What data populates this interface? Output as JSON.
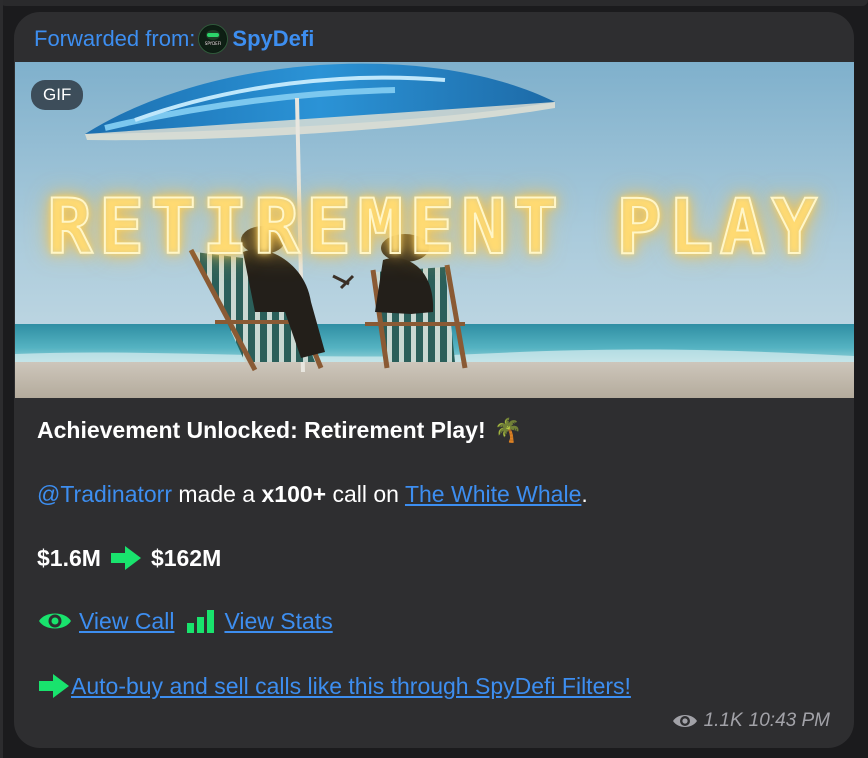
{
  "forwarded": {
    "prefix": "Forwarded from:",
    "channel": "SpyDefi",
    "avatar_icon": "spydefi-logo-icon"
  },
  "media": {
    "badge": "GIF",
    "overlay_text": "RETIREMENT PLAY",
    "scene": "beach-umbrella-two-deck-chairs"
  },
  "message": {
    "headline": "Achievement Unlocked: Retirement Play!",
    "headline_emoji": "🌴",
    "mention": "@Tradinatorr",
    "made_a": " made a ",
    "multiplier": "x100+",
    "call_on": " call on",
    "token_link": "The White Whale",
    "period": ".",
    "from_mc": "$1.6M",
    "to_mc": "$162M",
    "view_call": "View Call",
    "view_stats": "View Stats",
    "autobuy_link": "Auto-buy and sell calls like this through SpyDefi Filters!"
  },
  "meta": {
    "views": "1.1K",
    "time": "10:43 PM"
  },
  "colors": {
    "bubble": "#2e2e30",
    "link": "#3d8ef0",
    "accent_green": "#19e36d",
    "meta_text": "#a2a2a8"
  }
}
